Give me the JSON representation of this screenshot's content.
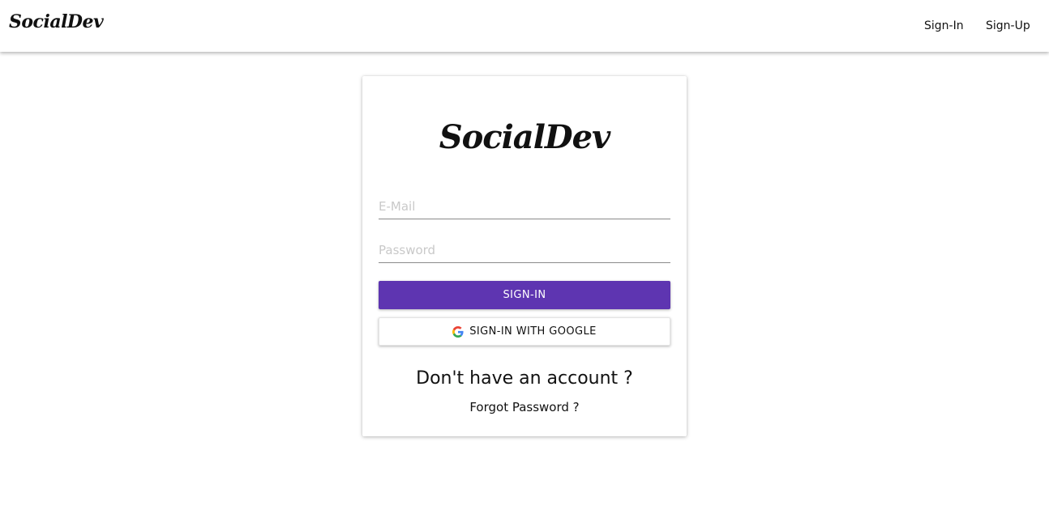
{
  "navbar": {
    "brand": "SocialDev",
    "links": [
      {
        "label": "Sign-In"
      },
      {
        "label": "Sign-Up"
      }
    ]
  },
  "card": {
    "logo": "SocialDev",
    "email": {
      "placeholder": "E-Mail",
      "value": ""
    },
    "password": {
      "placeholder": "Password",
      "value": ""
    },
    "signin_button": "SIGN-IN",
    "google_button": "SIGN-IN WITH GOOGLE",
    "google_icon": "google-icon",
    "no_account_text": "Don't have an account ?",
    "forgot_password": "Forgot Password ?"
  },
  "colors": {
    "primary": "#5e35b1",
    "background": "#ffffff",
    "text": "#111111"
  }
}
